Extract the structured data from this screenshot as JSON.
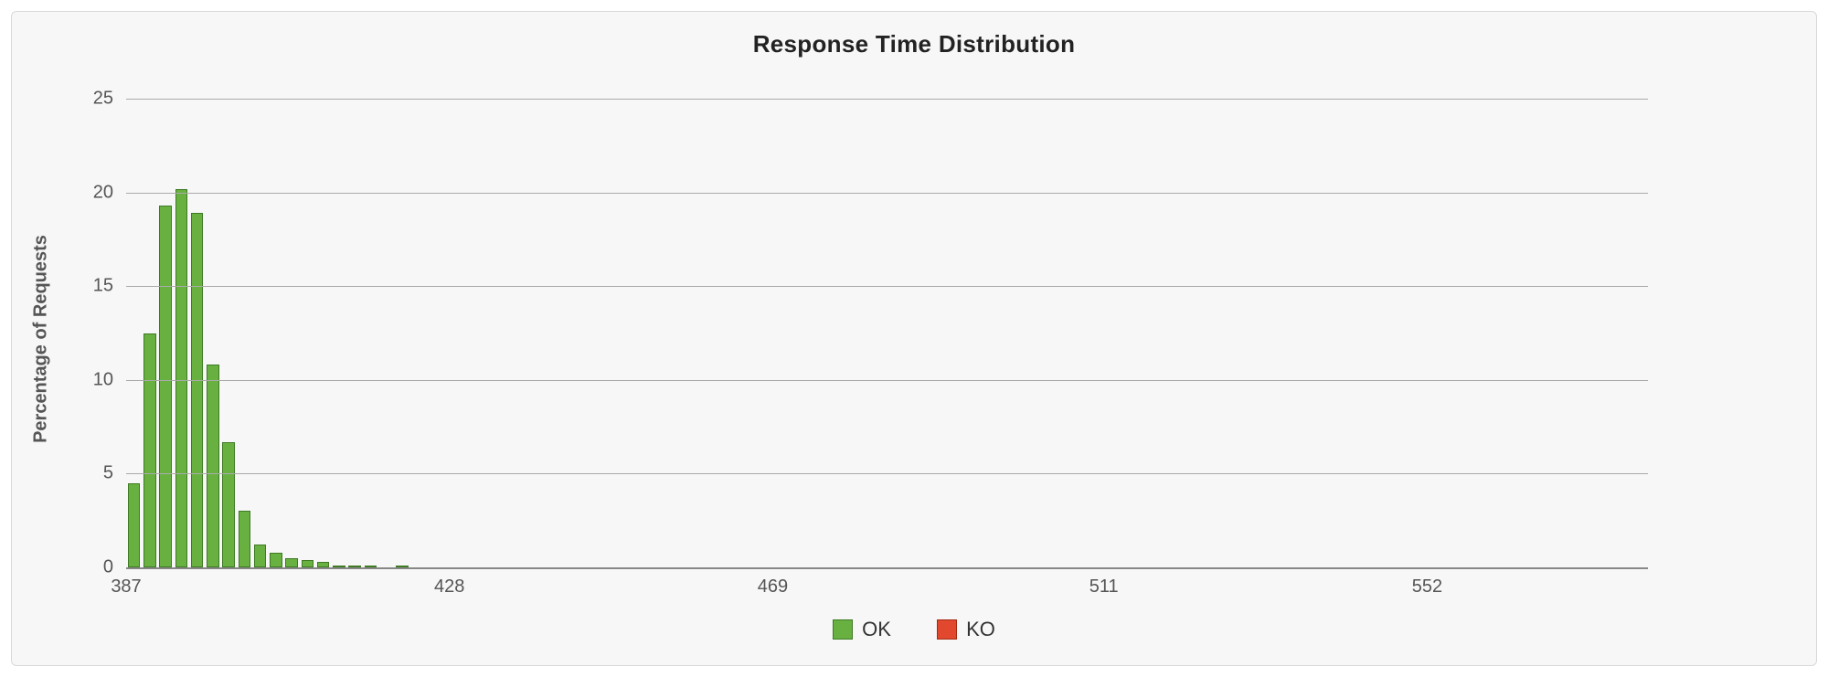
{
  "chart_data": {
    "type": "bar",
    "title": "Response Time Distribution",
    "xlabel": "",
    "ylabel": "Percentage of Requests",
    "ylim": [
      0,
      25
    ],
    "y_ticks": [
      0,
      5,
      10,
      15,
      20,
      25
    ],
    "x_range": [
      387,
      580
    ],
    "x_ticks": [
      387,
      428,
      469,
      511,
      552
    ],
    "series": [
      {
        "name": "OK",
        "color": "#68b141",
        "values": [
          4.5,
          12.5,
          19.3,
          20.2,
          18.9,
          10.8,
          6.7,
          3.0,
          1.2,
          0.8,
          0.5,
          0.4,
          0.3,
          0.1,
          0.1,
          0.1,
          0.0,
          0.1
        ]
      },
      {
        "name": "KO",
        "color": "#e2482d",
        "values": [
          0,
          0,
          0,
          0,
          0,
          0,
          0,
          0,
          0,
          0,
          0,
          0,
          0,
          0,
          0,
          0,
          0,
          0
        ]
      }
    ],
    "bin_start": 387,
    "bin_width": 2,
    "bar_width_ratio": 0.78,
    "legend": {
      "position": "bottom"
    }
  }
}
